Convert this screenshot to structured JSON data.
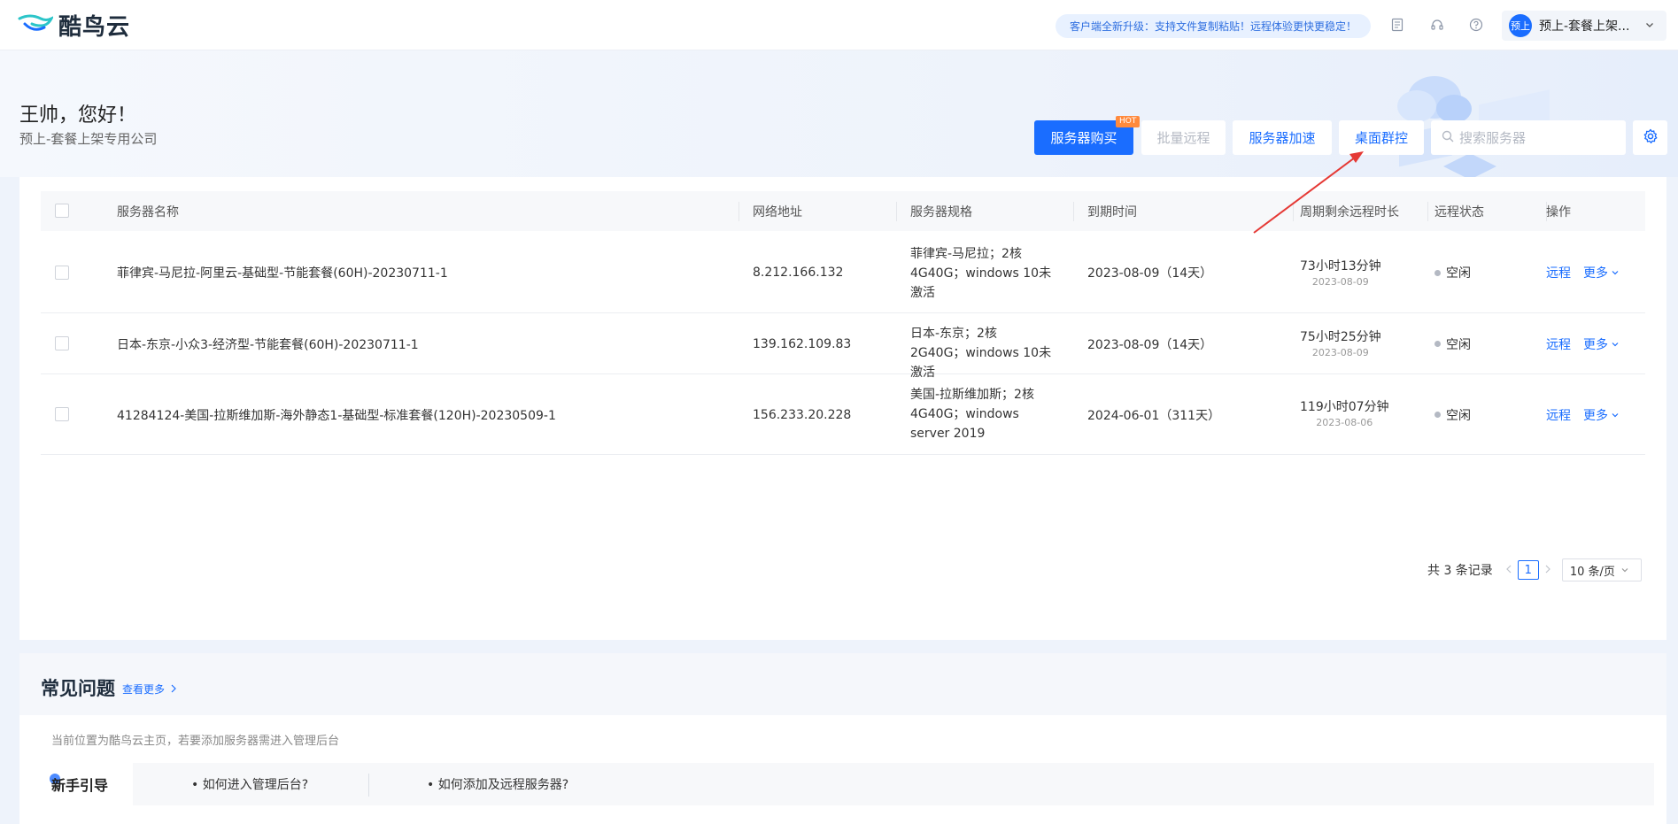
{
  "brand": {
    "name": "酷鸟云"
  },
  "notice": "客户端全新升级：支持文件复制粘贴！远程体验更快更稳定！",
  "user": {
    "avatar_text": "预上",
    "name": "预上-套餐上架..."
  },
  "greeting": {
    "hello": "王帅，您好！",
    "company": "预上-套餐上架专用公司"
  },
  "toolbar": {
    "buy_label": "服务器购买",
    "hot_badge": "HOT",
    "batch_label": "批量远程",
    "accelerate_label": "服务器加速",
    "group_control_label": "桌面群控",
    "search_placeholder": "搜索服务器"
  },
  "table": {
    "columns": [
      "服务器名称",
      "网络地址",
      "服务器规格",
      "到期时间",
      "周期剩余远程时长",
      "远程状态",
      "操作"
    ],
    "rows": [
      {
        "name": "菲律宾-马尼拉-阿里云-基础型-节能套餐(60H)-20230711-1",
        "ip": "8.212.166.132",
        "spec": "菲律宾-马尼拉；2核4G40G；windows 10未激活",
        "expire": "2023-08-09（14天）",
        "remaining": "73小时13分钟",
        "remaining_date": "2023-08-09",
        "status": "空闲",
        "remote": "远程",
        "more": "更多"
      },
      {
        "name": "日本-东京-小众3-经济型-节能套餐(60H)-20230711-1",
        "ip": "139.162.109.83",
        "spec": "日本-东京；2核2G40G；windows 10未激活",
        "expire": "2023-08-09（14天）",
        "remaining": "75小时25分钟",
        "remaining_date": "2023-08-09",
        "status": "空闲",
        "remote": "远程",
        "more": "更多"
      },
      {
        "name": "41284124-美国-拉斯维加斯-海外静态1-基础型-标准套餐(120H)-20230509-1",
        "ip": "156.233.20.228",
        "spec": "美国-拉斯维加斯；2核4G40G；windows server 2019",
        "expire": "2024-06-01（311天）",
        "remaining": "119小时07分钟",
        "remaining_date": "2023-08-06",
        "status": "空闲",
        "remote": "远程",
        "more": "更多"
      }
    ]
  },
  "pagination": {
    "total": "共 3 条记录",
    "current": "1",
    "page_size": "10 条/页"
  },
  "faq": {
    "title": "常见问题",
    "more": "查看更多",
    "path": "当前位置为酷鸟云主页，若要添加服务器需进入管理后台",
    "guide_label": "新手引导",
    "items": [
      "• 如何进入管理后台?",
      "• 如何添加及远程服务器?"
    ]
  },
  "colors": {
    "accent": "#1a6dff",
    "annotation_arrow": "#e53935"
  }
}
